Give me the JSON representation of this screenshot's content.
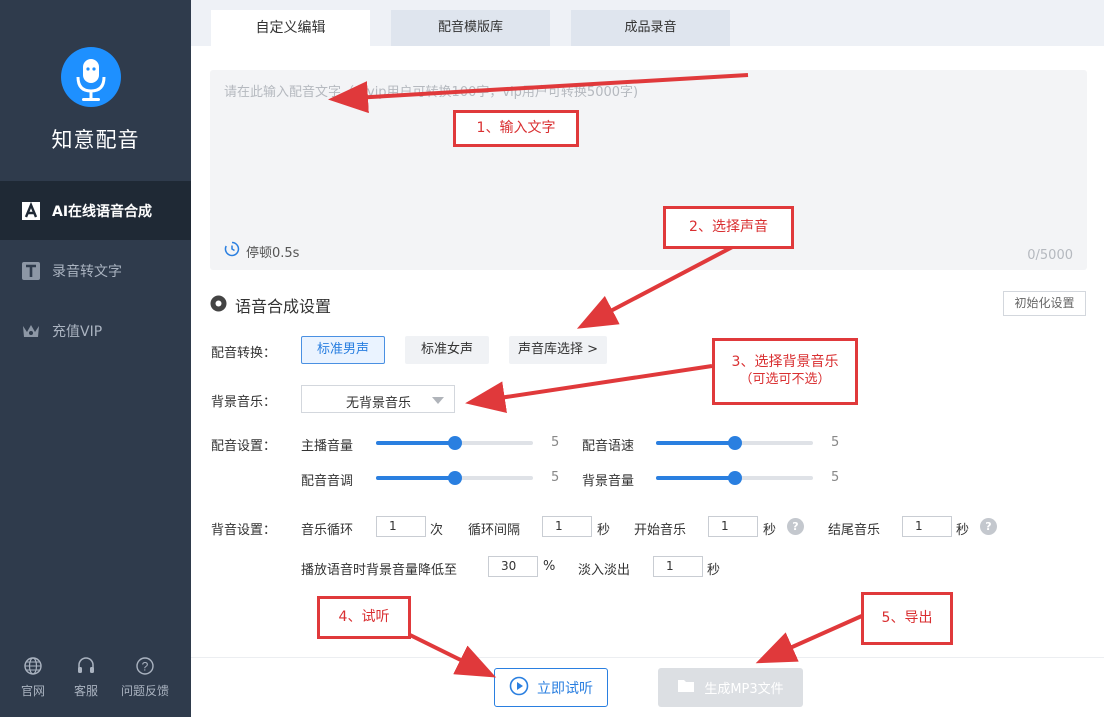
{
  "app": {
    "name": "知意配音"
  },
  "sidebar": {
    "items": [
      {
        "label": "AI在线语音合成",
        "icon": "text-a-icon",
        "active": true
      },
      {
        "label": "录音转文字",
        "icon": "text-t-icon",
        "active": false
      },
      {
        "label": "充值VIP",
        "icon": "crown-icon",
        "active": false
      }
    ],
    "bottom": [
      {
        "label": "官网",
        "icon": "globe-icon"
      },
      {
        "label": "客服",
        "icon": "headset-icon"
      },
      {
        "label": "问题反馈",
        "icon": "question-icon"
      }
    ]
  },
  "tabs": [
    {
      "label": "自定义编辑",
      "active": true
    },
    {
      "label": "配音模版库",
      "active": false
    },
    {
      "label": "成品录音",
      "active": false
    }
  ],
  "editor": {
    "placeholder": "请在此输入配音文字（非vip用户可转换100字，vip用户可转换5000字)",
    "pause_label": "停顿0.5s",
    "char_count": "0/5000"
  },
  "settings": {
    "title": "语音合成设置",
    "reset_label": "初始化设置",
    "voice_label": "配音转换：",
    "voices": [
      "标准男声",
      "标准女声",
      "声音库选择 >"
    ],
    "bgm_label": "背景音乐：",
    "bgm_value": "无背景音乐",
    "dub_label": "配音设置：",
    "sliders": [
      {
        "label": "主播音量",
        "value": 5,
        "max": 10
      },
      {
        "label": "配音语速",
        "value": 5,
        "max": 10
      },
      {
        "label": "配音音调",
        "value": 5,
        "max": 10
      },
      {
        "label": "背景音量",
        "value": 5,
        "max": 10
      }
    ],
    "bg_label": "背音设置：",
    "loop_label": "音乐循环",
    "loop_value": "1",
    "loop_unit": "次",
    "interval_label": "循环间隔",
    "interval_value": "1",
    "interval_unit": "秒",
    "start_label": "开始音乐",
    "start_value": "1",
    "start_unit": "秒",
    "end_label": "结尾音乐",
    "end_value": "1",
    "end_unit": "秒",
    "duck_label": "播放语音时背景音量降低至",
    "duck_value": "30",
    "duck_unit": "%",
    "fade_label": "淡入淡出",
    "fade_value": "1",
    "fade_unit": "秒"
  },
  "actions": {
    "play_label": "立即试听",
    "export_label": "生成MP3文件"
  },
  "annotations": [
    "1、输入文字",
    "2、选择声音",
    "3、选择背景音乐",
    "（可选可不选）",
    "4、试听",
    "5、导出"
  ],
  "colors": {
    "accent": "#2a7fe0",
    "sidebar": "#2f3b4c",
    "annotation": "#e0393b"
  }
}
